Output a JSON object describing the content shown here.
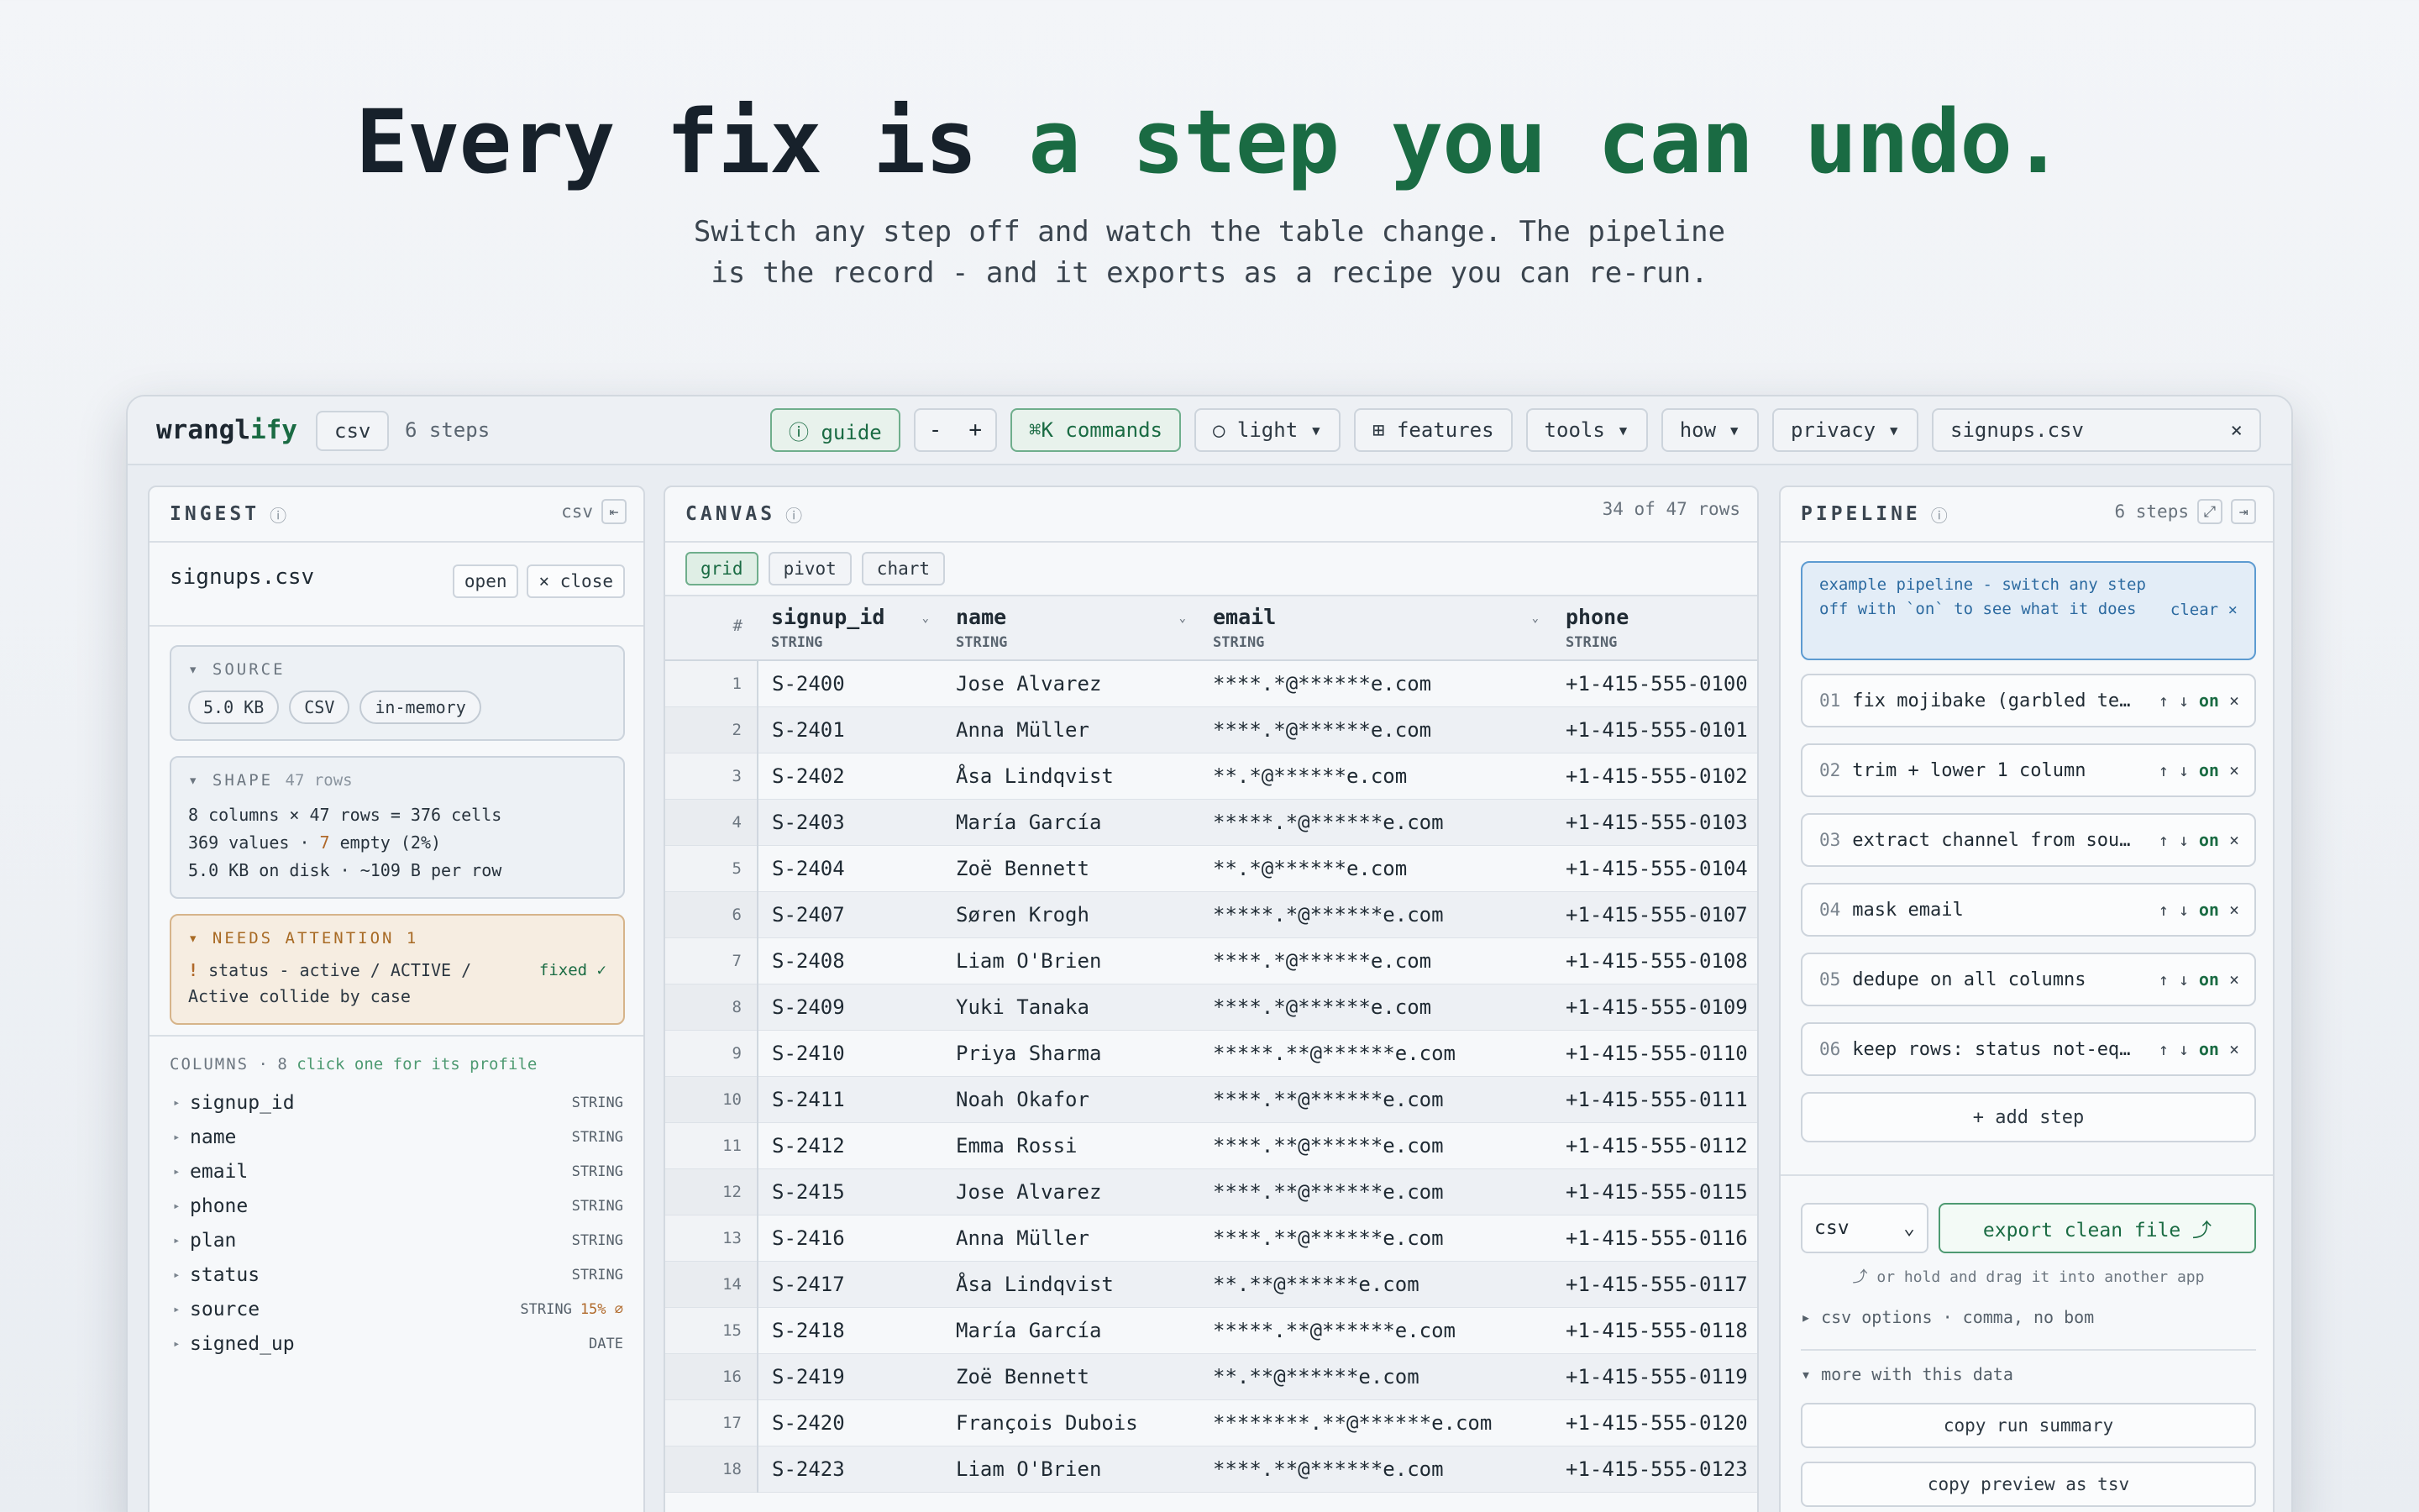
{
  "hero": {
    "headline_plain": "Every fix is ",
    "headline_accent": "a step you can undo.",
    "subline": "Switch any step off and watch the table change. The pipeline\nis the record - and it exports as a recipe you can re-run."
  },
  "topbar": {
    "brand_a": "wrangl",
    "brand_b": "ify",
    "format_chip": "csv",
    "steps_count": "6 steps",
    "guide": "ⓘ guide",
    "zoom_minus": "-",
    "zoom_plus": "+",
    "commands": "⌘K commands",
    "theme": "○ light ▾",
    "features": "⊞ features",
    "tools": "tools ▾",
    "how": "how ▾",
    "privacy": "privacy ▾",
    "file": "signups.csv",
    "close": "×"
  },
  "ingest": {
    "title": "INGEST",
    "info": "ⓘ",
    "format": "csv",
    "collapse": "⇤",
    "filename": "signups.csv",
    "open": "open",
    "close": "× close",
    "source_label": "▾ SOURCE",
    "source_pills": [
      "5.0 KB",
      "CSV",
      "in-memory"
    ],
    "shape_label": "▾ SHAPE",
    "shape_rows": "47 rows",
    "shape_line1": "8 columns × 47 rows = 376 cells",
    "shape_line2a": "369 values · ",
    "shape_line2b": "7",
    "shape_line2c": " empty (2%)",
    "shape_line3": "5.0 KB on disk · ~109 B per row",
    "attn_label": "▾ NEEDS ATTENTION 1",
    "attn_mark": "!",
    "attn_text": " status - active / ACTIVE / Active collide by case",
    "attn_fixed": "fixed ✓",
    "cols_label": "COLUMNS",
    "cols_count": " · 8 ",
    "cols_hint": "click one for its profile",
    "columns": [
      {
        "name": "signup_id",
        "type": "STRING",
        "warn": ""
      },
      {
        "name": "name",
        "type": "STRING",
        "warn": ""
      },
      {
        "name": "email",
        "type": "STRING",
        "warn": ""
      },
      {
        "name": "phone",
        "type": "STRING",
        "warn": ""
      },
      {
        "name": "plan",
        "type": "STRING",
        "warn": ""
      },
      {
        "name": "status",
        "type": "STRING",
        "warn": ""
      },
      {
        "name": "source",
        "type": "STRING",
        "warn": "15% ⌀"
      },
      {
        "name": "signed_up",
        "type": "DATE",
        "warn": ""
      }
    ]
  },
  "canvas": {
    "title": "CANVAS",
    "info": "ⓘ",
    "rows_info": "34 of 47 rows",
    "tabs": [
      "grid",
      "pivot",
      "chart"
    ],
    "rownum_header": "#",
    "headers": [
      {
        "name": "signup_id",
        "type": "STRING"
      },
      {
        "name": "name",
        "type": "STRING"
      },
      {
        "name": "email",
        "type": "STRING"
      },
      {
        "name": "phone",
        "type": "STRING"
      }
    ],
    "rows": [
      [
        "1",
        "S-2400",
        "Jose Alvarez",
        "****.*@******e.com",
        "+1-415-555-0100"
      ],
      [
        "2",
        "S-2401",
        "Anna Müller",
        "****.*@******e.com",
        "+1-415-555-0101"
      ],
      [
        "3",
        "S-2402",
        "Åsa Lindqvist",
        "**.*@******e.com",
        "+1-415-555-0102"
      ],
      [
        "4",
        "S-2403",
        "María García",
        "*****.*@******e.com",
        "+1-415-555-0103"
      ],
      [
        "5",
        "S-2404",
        "Zoë Bennett",
        "**.*@******e.com",
        "+1-415-555-0104"
      ],
      [
        "6",
        "S-2407",
        "Søren Krogh",
        "*****.*@******e.com",
        "+1-415-555-0107"
      ],
      [
        "7",
        "S-2408",
        "Liam O'Brien",
        "****.*@******e.com",
        "+1-415-555-0108"
      ],
      [
        "8",
        "S-2409",
        "Yuki Tanaka",
        "****.*@******e.com",
        "+1-415-555-0109"
      ],
      [
        "9",
        "S-2410",
        "Priya Sharma",
        "*****.**@******e.com",
        "+1-415-555-0110"
      ],
      [
        "10",
        "S-2411",
        "Noah Okafor",
        "****.**@******e.com",
        "+1-415-555-0111"
      ],
      [
        "11",
        "S-2412",
        "Emma Rossi",
        "****.**@******e.com",
        "+1-415-555-0112"
      ],
      [
        "12",
        "S-2415",
        "Jose Alvarez",
        "****.**@******e.com",
        "+1-415-555-0115"
      ],
      [
        "13",
        "S-2416",
        "Anna Müller",
        "****.**@******e.com",
        "+1-415-555-0116"
      ],
      [
        "14",
        "S-2417",
        "Åsa Lindqvist",
        "**.**@******e.com",
        "+1-415-555-0117"
      ],
      [
        "15",
        "S-2418",
        "María García",
        "*****.**@******e.com",
        "+1-415-555-0118"
      ],
      [
        "16",
        "S-2419",
        "Zoë Bennett",
        "**.**@******e.com",
        "+1-415-555-0119"
      ],
      [
        "17",
        "S-2420",
        "François Dubois",
        "********.**@******e.com",
        "+1-415-555-0120"
      ],
      [
        "18",
        "S-2423",
        "Liam O'Brien",
        "****.**@******e.com",
        "+1-415-555-0123"
      ]
    ]
  },
  "pipeline": {
    "title": "PIPELINE",
    "info": "ⓘ",
    "steps_count": "6 steps",
    "expand": "⤢",
    "collapse": "⇥",
    "banner": "example pipeline - switch any step off with `on` to see what it does",
    "banner_clear": "clear ×",
    "steps": [
      {
        "num": "01",
        "label": "fix mojibake (garbled text)",
        "state": "on"
      },
      {
        "num": "02",
        "label": "trim + lower 1 column",
        "state": "on"
      },
      {
        "num": "03",
        "label": "extract channel from source",
        "state": "on"
      },
      {
        "num": "04",
        "label": "mask email",
        "state": "on"
      },
      {
        "num": "05",
        "label": "dedupe on all columns",
        "state": "on"
      },
      {
        "num": "06",
        "label": "keep rows: status not-equal",
        "state": "on"
      }
    ],
    "up": "↑",
    "down": "↓",
    "remove": "×",
    "add_step": "+ add step",
    "export_format": "csv",
    "export_button": "export clean file ⤴",
    "drag_hint": "⤴ or hold and drag it into another app",
    "csv_options": "▸ csv options · comma, no bom",
    "more": "▾ more with this data",
    "copy_summary": "copy run summary",
    "copy_tsv": "copy preview as tsv"
  }
}
